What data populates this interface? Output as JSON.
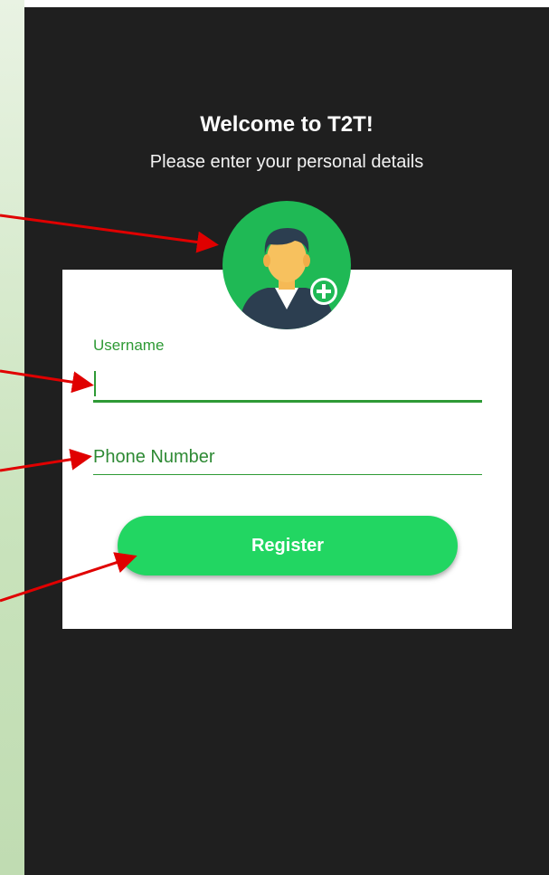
{
  "header": {
    "title": "Welcome to T2T!",
    "subtitle": "Please enter your personal details"
  },
  "avatar": {
    "icon": "user-avatar-add-icon",
    "add_icon": "plus-circle-icon"
  },
  "form": {
    "username_label": "Username",
    "username_value": "",
    "phone_placeholder": "Phone Number",
    "register_label": "Register"
  },
  "colors": {
    "accent": "#2e9a35",
    "button": "#22d662",
    "background": "#1f1f1f",
    "card": "#ffffff",
    "annotation_arrow": "#e00000"
  }
}
